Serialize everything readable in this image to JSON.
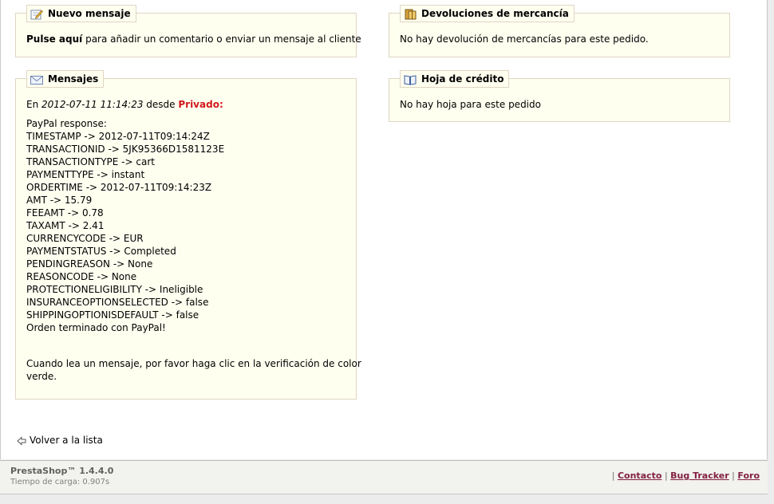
{
  "nuevo_mensaje": {
    "title": "Nuevo mensaje",
    "text_bold": "Pulse aquí",
    "text_rest": " para añadir un comentario o enviar un mensaje al cliente"
  },
  "devoluciones": {
    "title": "Devoluciones de mercancía",
    "text": "No hay devolución de mercancías para este pedido."
  },
  "mensajes": {
    "title": "Mensajes",
    "header_en": "En ",
    "header_date": "2012-07-11 11:14:23",
    "header_desde": " desde ",
    "header_privado": "Privado:",
    "lines": [
      "PayPal response:",
      "TIMESTAMP -> 2012-07-11T09:14:24Z",
      "TRANSACTIONID -> 5JK95366D1581123E",
      "TRANSACTIONTYPE -> cart",
      "PAYMENTTYPE -> instant",
      "ORDERTIME -> 2012-07-11T09:14:23Z",
      "AMT -> 15.79",
      "FEEAMT -> 0.78",
      "TAXAMT -> 2.41",
      "CURRENCYCODE -> EUR",
      "PAYMENTSTATUS -> Completed",
      "PENDINGREASON -> None",
      "REASONCODE -> None",
      "PROTECTIONELIGIBILITY -> Ineligible",
      "INSURANCEOPTIONSELECTED -> false",
      "SHIPPINGOPTIONISDEFAULT -> false",
      "Orden terminado con PayPal!"
    ],
    "note_line1": "Cuando lea un mensaje, por favor haga clic en la verificación de color",
    "note_line2": "verde."
  },
  "hoja_credito": {
    "title": "Hoja de crédito",
    "text": "No hay hoja para este pedido"
  },
  "back_link": "Volver a la lista",
  "footer": {
    "brand": "PrestaShop™ 1.4.4.0",
    "load_time": "Tiempo de carga: 0.907s",
    "sep": "|",
    "links": [
      "Contacto",
      "Bug Tracker",
      "Foro"
    ]
  }
}
